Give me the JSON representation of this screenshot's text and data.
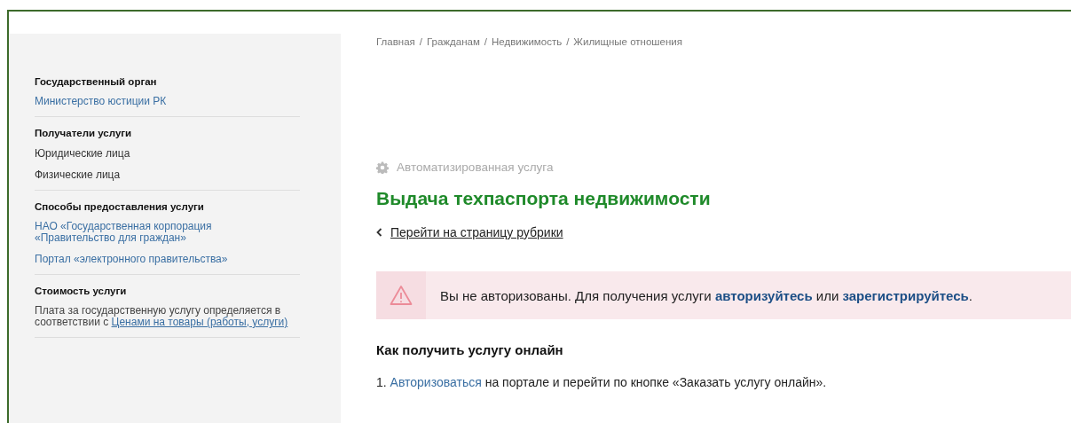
{
  "sidebar": {
    "sections": [
      {
        "title": "Государственный орган",
        "items": [
          {
            "kind": "link",
            "text": "Министерство юстиции РК"
          }
        ]
      },
      {
        "title": "Получатели услуги",
        "items": [
          {
            "kind": "plain",
            "text": "Юридические лица"
          },
          {
            "kind": "plain",
            "text": "Физические лица"
          }
        ]
      },
      {
        "title": "Способы предоставления услуги",
        "items": [
          {
            "kind": "link",
            "text": "НАО «Государственная корпорация «Правительство для граждан»"
          },
          {
            "kind": "link",
            "text": "Портал «электронного правительства»"
          }
        ]
      },
      {
        "title": "Стоимость услуги",
        "items": [
          {
            "kind": "note",
            "text": "Плата за государственную услугу определяется в соответствии с ",
            "link": "Ценами на товары (работы, услуги)"
          }
        ]
      }
    ]
  },
  "breadcrumbs": [
    "Главная",
    "Гражданам",
    "Недвижимость",
    "Жилищные отношения"
  ],
  "breadcrumb_separator": "/",
  "service_type": "Автоматизированная услуга",
  "title": "Выдача техпаспорта недвижимости",
  "back_link": "Перейти на страницу рубрики",
  "alert": {
    "text": "Вы не авторизованы. Для получения услуги ",
    "link1": "авторизуйтесь",
    "middle": " или ",
    "link2": "зарегистрируйтесь",
    "end": "."
  },
  "how_to": {
    "heading": "Как получить услугу онлайн",
    "steps": [
      {
        "number": "1.",
        "link": "Авторизоваться",
        "text": " на портале и перейти по кнопке «Заказать услугу онлайн»."
      }
    ]
  }
}
